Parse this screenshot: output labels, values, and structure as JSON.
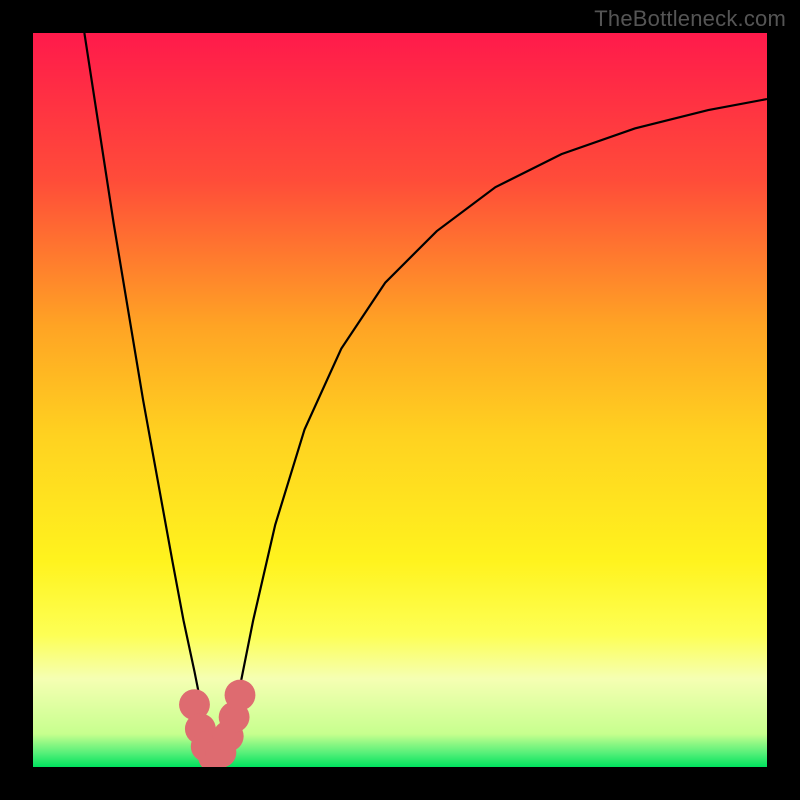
{
  "credit": "TheBottleneck.com",
  "colors": {
    "frame": "#000000",
    "curve_stroke": "#000000",
    "marker_fill": "#de6b70",
    "band_green": "#00e25e",
    "band_pale": "#f5ffb3"
  },
  "chart_data": {
    "type": "line",
    "title": "",
    "xlabel": "",
    "ylabel": "",
    "xlim": [
      0,
      100
    ],
    "ylim": [
      0,
      100
    ],
    "grid": false,
    "legend": false,
    "gradient_stops": [
      {
        "pos": 0.0,
        "color": "#ff1a4b"
      },
      {
        "pos": 0.2,
        "color": "#ff4c39"
      },
      {
        "pos": 0.4,
        "color": "#ffa424"
      },
      {
        "pos": 0.55,
        "color": "#ffd220"
      },
      {
        "pos": 0.72,
        "color": "#fff31e"
      },
      {
        "pos": 0.82,
        "color": "#fdff55"
      },
      {
        "pos": 0.88,
        "color": "#f5ffb3"
      },
      {
        "pos": 0.955,
        "color": "#c7ff8e"
      },
      {
        "pos": 0.98,
        "color": "#5af07a"
      },
      {
        "pos": 1.0,
        "color": "#00e25e"
      }
    ],
    "series": [
      {
        "name": "bottleneck-curve",
        "x": [
          7,
          9,
          11,
          13,
          15,
          17,
          19,
          20.5,
          22,
          23,
          24,
          25,
          26.5,
          28,
          30,
          33,
          37,
          42,
          48,
          55,
          63,
          72,
          82,
          92,
          100
        ],
        "y": [
          100,
          87,
          74,
          62,
          50,
          39,
          28,
          20,
          13,
          8,
          4,
          1,
          4,
          10,
          20,
          33,
          46,
          57,
          66,
          73,
          79,
          83.5,
          87,
          89.5,
          91
        ]
      }
    ],
    "markers": {
      "name": "trough-dots",
      "x": [
        22.0,
        22.8,
        23.6,
        24.6,
        25.6,
        26.6,
        27.4,
        28.2
      ],
      "y": [
        8.5,
        5.2,
        2.8,
        1.4,
        2.0,
        4.2,
        6.8,
        9.8
      ],
      "r": 2.1
    }
  }
}
